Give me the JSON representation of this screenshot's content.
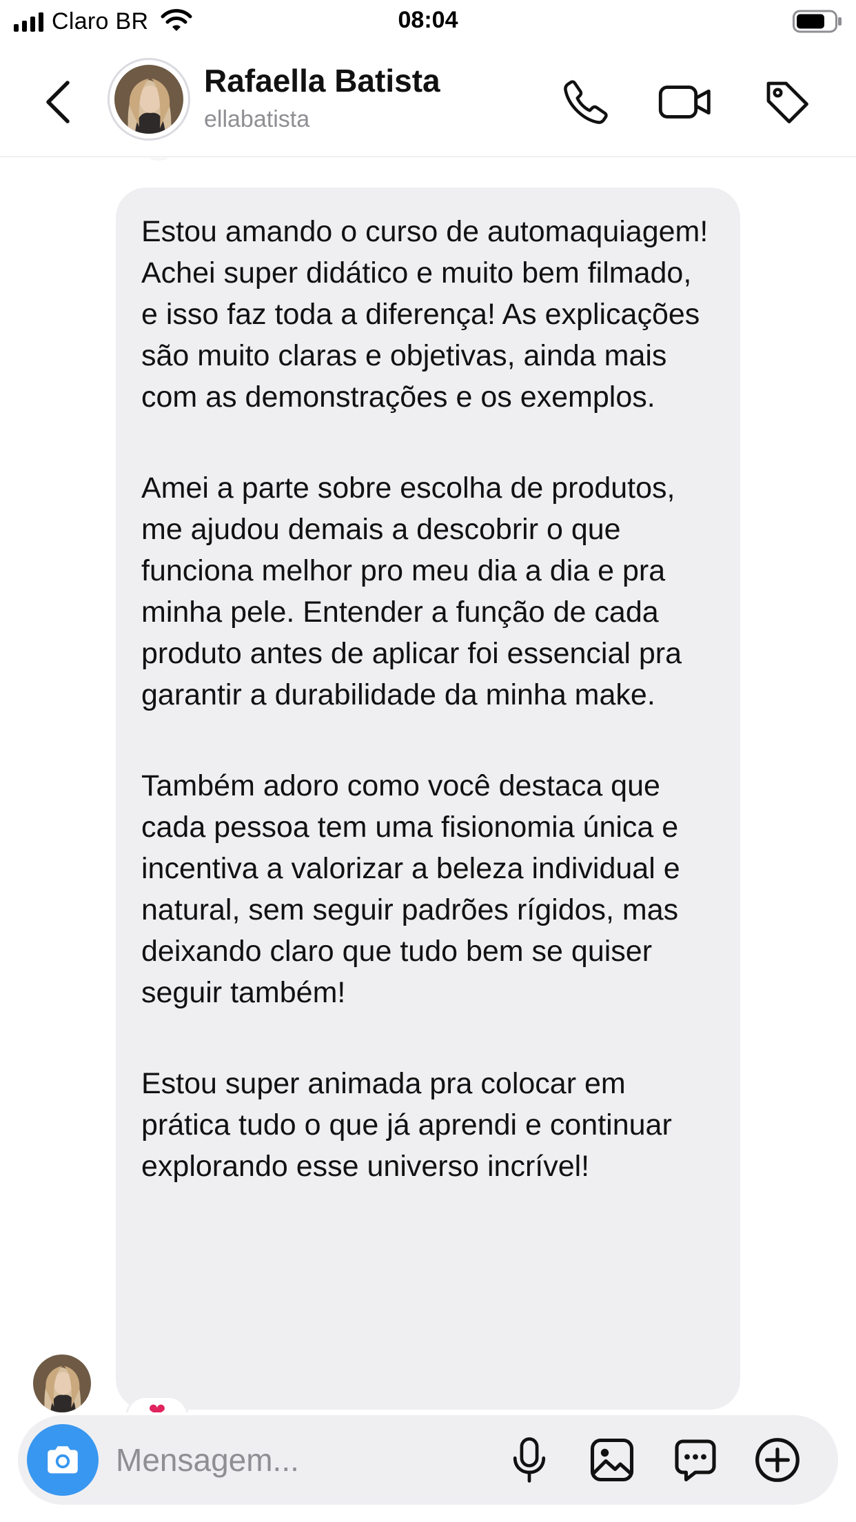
{
  "status_bar": {
    "carrier": "Claro BR",
    "time": "08:04",
    "icons": [
      "signal-icon",
      "wifi-icon",
      "battery-icon"
    ]
  },
  "header": {
    "name": "Rafaella Batista",
    "username": "ellabatista",
    "icons": [
      "back-arrow-icon",
      "phone-icon",
      "video-camera-icon",
      "tag-icon"
    ]
  },
  "chat": {
    "message_paragraphs": [
      "Estou amando o curso de automaquiagem! Achei super didático e muito bem filmado, e isso faz toda a diferença! As explicações são muito claras e objetivas, ainda mais com as demonstrações e os exemplos.",
      "Amei a parte sobre escolha de produtos, me ajudou demais a descobrir o que funciona melhor pro meu dia a dia e pra minha pele. Entender a função de cada produto antes de aplicar foi essencial pra garantir a durabilidade da minha make.",
      "Também adoro como você destaca que cada pessoa tem uma fisionomia única e incentiva a valorizar a beleza individual e natural, sem seguir padrões rígidos, mas deixando claro que tudo bem se quiser seguir também!",
      "Estou super animada pra colocar em prática tudo o que já aprendi e continuar explorando esse universo incrível!"
    ],
    "reaction": "❤"
  },
  "composer": {
    "placeholder": "Mensagem...",
    "icons": [
      "camera-icon",
      "microphone-icon",
      "gallery-icon",
      "sticker-chat-icon",
      "add-icon"
    ]
  },
  "colors": {
    "accent_blue": "#3897f0",
    "bubble_gray": "#efeff2",
    "secondary_text": "#8e8e93",
    "reaction_red": "#e0245e"
  }
}
